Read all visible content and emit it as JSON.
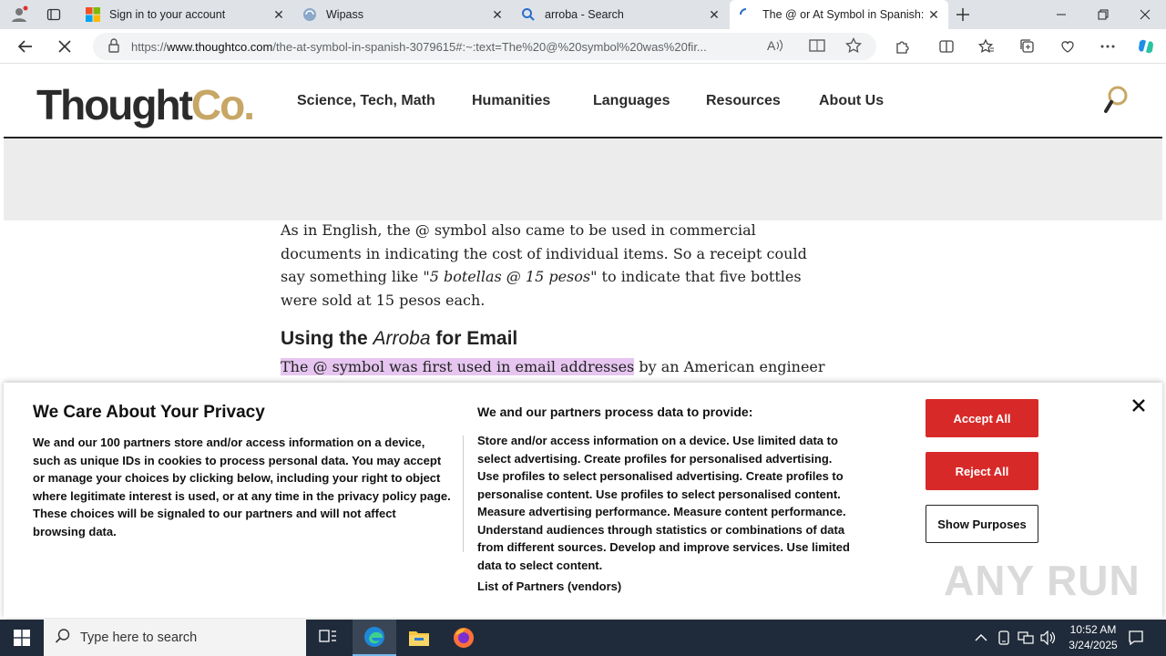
{
  "browser": {
    "tabs": [
      {
        "label": "Sign in to your account",
        "icon": "microsoft-logo-icon"
      },
      {
        "label": "Wipass",
        "icon": "wipass-icon"
      },
      {
        "label": "arroba - Search",
        "icon": "search-icon"
      },
      {
        "label": "The @ or At Symbol in Spanish: N",
        "icon": "thoughtco-icon"
      }
    ],
    "url_prefix": "https://",
    "url_domain": "www.thoughtco.com",
    "url_rest": "/the-at-symbol-in-spanish-3079615#:~:text=The%20@%20symbol%20was%20fir..."
  },
  "site": {
    "logo_main": "Thought",
    "logo_accent": "Co.",
    "nav": [
      "Science, Tech, Math",
      "Humanities",
      "Languages",
      "Resources",
      "About Us"
    ]
  },
  "article": {
    "p1_a": "As in English, the @ symbol also came to be used in commercial documents in indicating the cost of individual items. So a receipt could say something like \"",
    "p1_em": "5 botellas @ 15 pesos",
    "p1_b": "\" to indicate that five bottles were sold at 15 pesos each.",
    "h2_a": "Using the ",
    "h2_em": "Arroba",
    "h2_b": " for Email",
    "p2_hl": "The @ symbol was first used in email addresses",
    "p2_rest": " by an American engineer"
  },
  "consent": {
    "title": "We Care About Your Privacy",
    "body": "We and our 100 partners store and/or access information on a device, such as unique IDs in cookies to process personal data. You may accept or manage your choices by clicking below, including your right to object where legitimate interest is used, or at any time in the privacy policy page. These choices will be signaled to our partners and will not affect browsing data.",
    "subtitle": "We and our partners process data to provide:",
    "purposes": "Store and/or access information on a device. Use limited data to select advertising. Create profiles for personalised advertising. Use profiles to select personalised advertising. Create profiles to personalise content. Use profiles to select personalised content. Measure advertising performance. Measure content performance. Understand audiences through statistics or combinations of data from different sources. Develop and improve services. Use limited data to select content.",
    "partners_link": "List of Partners (vendors)",
    "accept": "Accept All",
    "reject": "Reject All",
    "purposes_btn": "Show Purposes"
  },
  "watermark": "ANY RUN",
  "taskbar": {
    "search_placeholder": "Type here to search",
    "time": "10:52 AM",
    "date": "3/24/2025"
  }
}
